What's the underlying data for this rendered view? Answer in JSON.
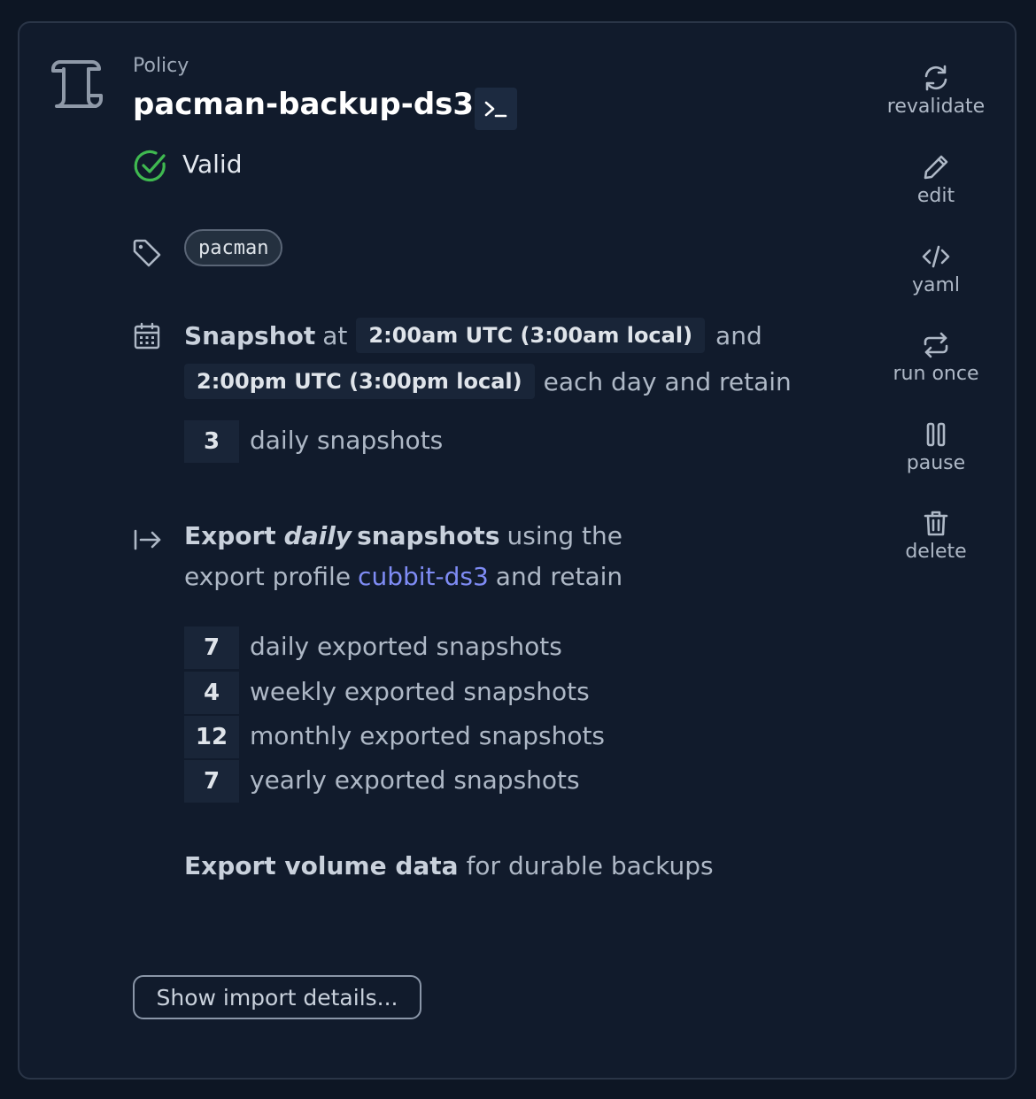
{
  "policy": {
    "kind_label": "Policy",
    "name": "pacman-backup-ds3",
    "status": "Valid",
    "tags": [
      "pacman"
    ]
  },
  "schedule": {
    "lead_strong": "Snapshot",
    "at_word": "at",
    "time1": "2:00am UTC (3:00am local)",
    "and_word": "and",
    "time2": "2:00pm UTC (3:00pm local)",
    "tail": "each day and retain",
    "retain_count": "3",
    "retain_label": "daily snapshots"
  },
  "export": {
    "lead_strong": "Export",
    "lead_em": "daily",
    "lead_strong2": "snapshots",
    "lead_rest": "using the",
    "line2_prefix": "export profile",
    "profile_link": "cubbit-ds3",
    "line2_suffix": "and retain",
    "retention": [
      {
        "count": "7",
        "label": "daily exported snapshots"
      },
      {
        "count": "4",
        "label": "weekly exported snapshots"
      },
      {
        "count": "12",
        "label": "monthly exported snapshots"
      },
      {
        "count": "7",
        "label": "yearly exported snapshots"
      }
    ],
    "volume_strong": "Export volume data",
    "volume_rest": "for durable backups"
  },
  "show_import_button": "Show import details...",
  "actions": [
    {
      "label": "revalidate",
      "icon": "refresh-icon"
    },
    {
      "label": "edit",
      "icon": "pencil-icon"
    },
    {
      "label": "yaml",
      "icon": "code-icon"
    },
    {
      "label": "run once",
      "icon": "repeat-icon"
    },
    {
      "label": "pause",
      "icon": "pause-icon"
    },
    {
      "label": "delete",
      "icon": "trash-icon"
    }
  ],
  "colors": {
    "background": "#0d1624",
    "card": "#111b2c",
    "valid_green": "#3fb950",
    "link": "#7f8cf5"
  }
}
